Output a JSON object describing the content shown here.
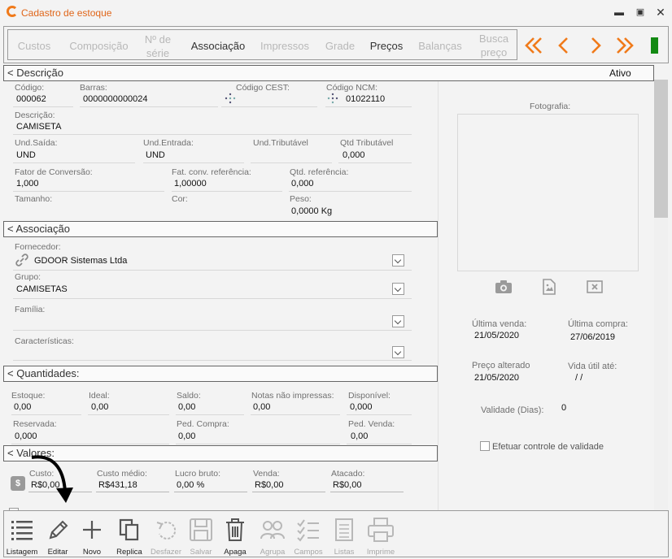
{
  "window": {
    "title": "Cadastro de estoque",
    "controls": [
      "minimize-icon",
      "maximize-icon",
      "close-icon"
    ]
  },
  "tabs": [
    {
      "label": "Custos",
      "active": false
    },
    {
      "label": "Composição",
      "active": false
    },
    {
      "label": "Nº de série",
      "active": false
    },
    {
      "label": "Associação",
      "active": true
    },
    {
      "label": "Impressos",
      "active": false
    },
    {
      "label": "Grade",
      "active": false
    },
    {
      "label": "Preços",
      "active": true
    },
    {
      "label": "Balanças",
      "active": false
    },
    {
      "label": "Busca preço",
      "active": false
    }
  ],
  "nav": {
    "icons": [
      "double-chevron-left-icon",
      "chevron-left-icon",
      "chevron-right-icon",
      "double-chevron-right-icon"
    ],
    "accent": "#f07a1a",
    "status_color": "#138a13"
  },
  "descricao": {
    "header": "< Descrição",
    "status": "Ativo",
    "codigo_label": "Código:",
    "codigo": "000062",
    "barras_label": "Barras:",
    "barras": "0000000000024",
    "cest_label": "Código CEST:",
    "ncm_label": "Código NCM:",
    "ncm": "01022110",
    "descricao_label": "Descrição:",
    "descricao": "CAMISETA",
    "und_saida_label": "Und.Saída:",
    "und_saida": "UND",
    "und_entrada_label": "Und.Entrada:",
    "und_entrada": "UND",
    "und_trib_label": "Und.Tributável",
    "qtd_trib_label": "Qtd Tributável",
    "qtd_trib": "0,000",
    "fator_label": "Fator de Conversão:",
    "fator": "1,000",
    "fat_ref_label": "Fat. conv. referência:",
    "fat_ref": "1,00000",
    "qtd_ref_label": "Qtd. referência:",
    "qtd_ref": "0,000",
    "tamanho_label": "Tamanho:",
    "cor_label": "Cor:",
    "peso_label": "Peso:",
    "peso": "0,0000 Kg"
  },
  "associacao": {
    "header": "< Associação",
    "fornecedor_label": "Fornecedor:",
    "fornecedor": "GDOOR Sistemas Ltda",
    "grupo_label": "Grupo:",
    "grupo": "CAMISETAS",
    "familia_label": "Família:",
    "caract_label": "Características:"
  },
  "quantidades": {
    "header": "< Quantidades:",
    "estoque_label": "Estoque:",
    "estoque": "0,00",
    "ideal_label": "Ideal:",
    "ideal": "0,00",
    "saldo_label": "Saldo:",
    "saldo": "0,00",
    "notas_label": "Notas não impressas:",
    "notas": "0,00",
    "disponivel_label": "Disponível:",
    "disponivel": "0,000",
    "reservada_label": "Reservada:",
    "reservada": "0,000",
    "ped_compra_label": "Ped. Compra:",
    "ped_compra": "0,00",
    "ped_venda_label": "Ped. Venda:",
    "ped_venda": "0,00"
  },
  "valores": {
    "header": "< Valores:",
    "custo_label": "Custo:",
    "custo": "R$0,00",
    "custo_medio_label": "Custo médio:",
    "custo_medio": "R$431,18",
    "lucro_label": "Lucro bruto:",
    "lucro": "0,00 %",
    "venda_label": "Venda:",
    "venda": "R$0,00",
    "atacado_label": "Atacado:",
    "atacado": "R$0,00"
  },
  "foto": {
    "label": "Fotografia:",
    "icons": [
      "camera-icon",
      "image-file-icon",
      "remove-photo-icon"
    ]
  },
  "info": {
    "ultima_venda_label": "Última venda:",
    "ultima_venda": "21/05/2020",
    "ultima_compra_label": "Última compra:",
    "ultima_compra": "27/06/2019",
    "preco_alterado_label": "Preço alterado",
    "preco_alterado": "21/05/2020",
    "vida_util_label": "Vida útil até:",
    "vida_util": "/  /",
    "validade_label": "Validade (Dias):",
    "validade": "0",
    "controle_validade_label": "Efetuar controle de validade"
  },
  "toolbar": [
    {
      "label": "Listagem",
      "icon": "list-icon",
      "enabled": true
    },
    {
      "label": "Editar",
      "icon": "pencil-icon",
      "enabled": true
    },
    {
      "label": "Novo",
      "icon": "plus-icon",
      "enabled": true
    },
    {
      "label": "Replica",
      "icon": "copy-icon",
      "enabled": true
    },
    {
      "label": "Desfazer",
      "icon": "undo-icon",
      "enabled": false
    },
    {
      "label": "Salvar",
      "icon": "save-icon",
      "enabled": false
    },
    {
      "label": "Apaga",
      "icon": "trash-icon",
      "enabled": true
    },
    {
      "label": "Agrupa",
      "icon": "group-icon",
      "enabled": false
    },
    {
      "label": "Campos",
      "icon": "checklist-icon",
      "enabled": false
    },
    {
      "label": "Listas",
      "icon": "list-doc-icon",
      "enabled": false
    },
    {
      "label": "Imprime",
      "icon": "printer-icon",
      "enabled": false
    }
  ]
}
